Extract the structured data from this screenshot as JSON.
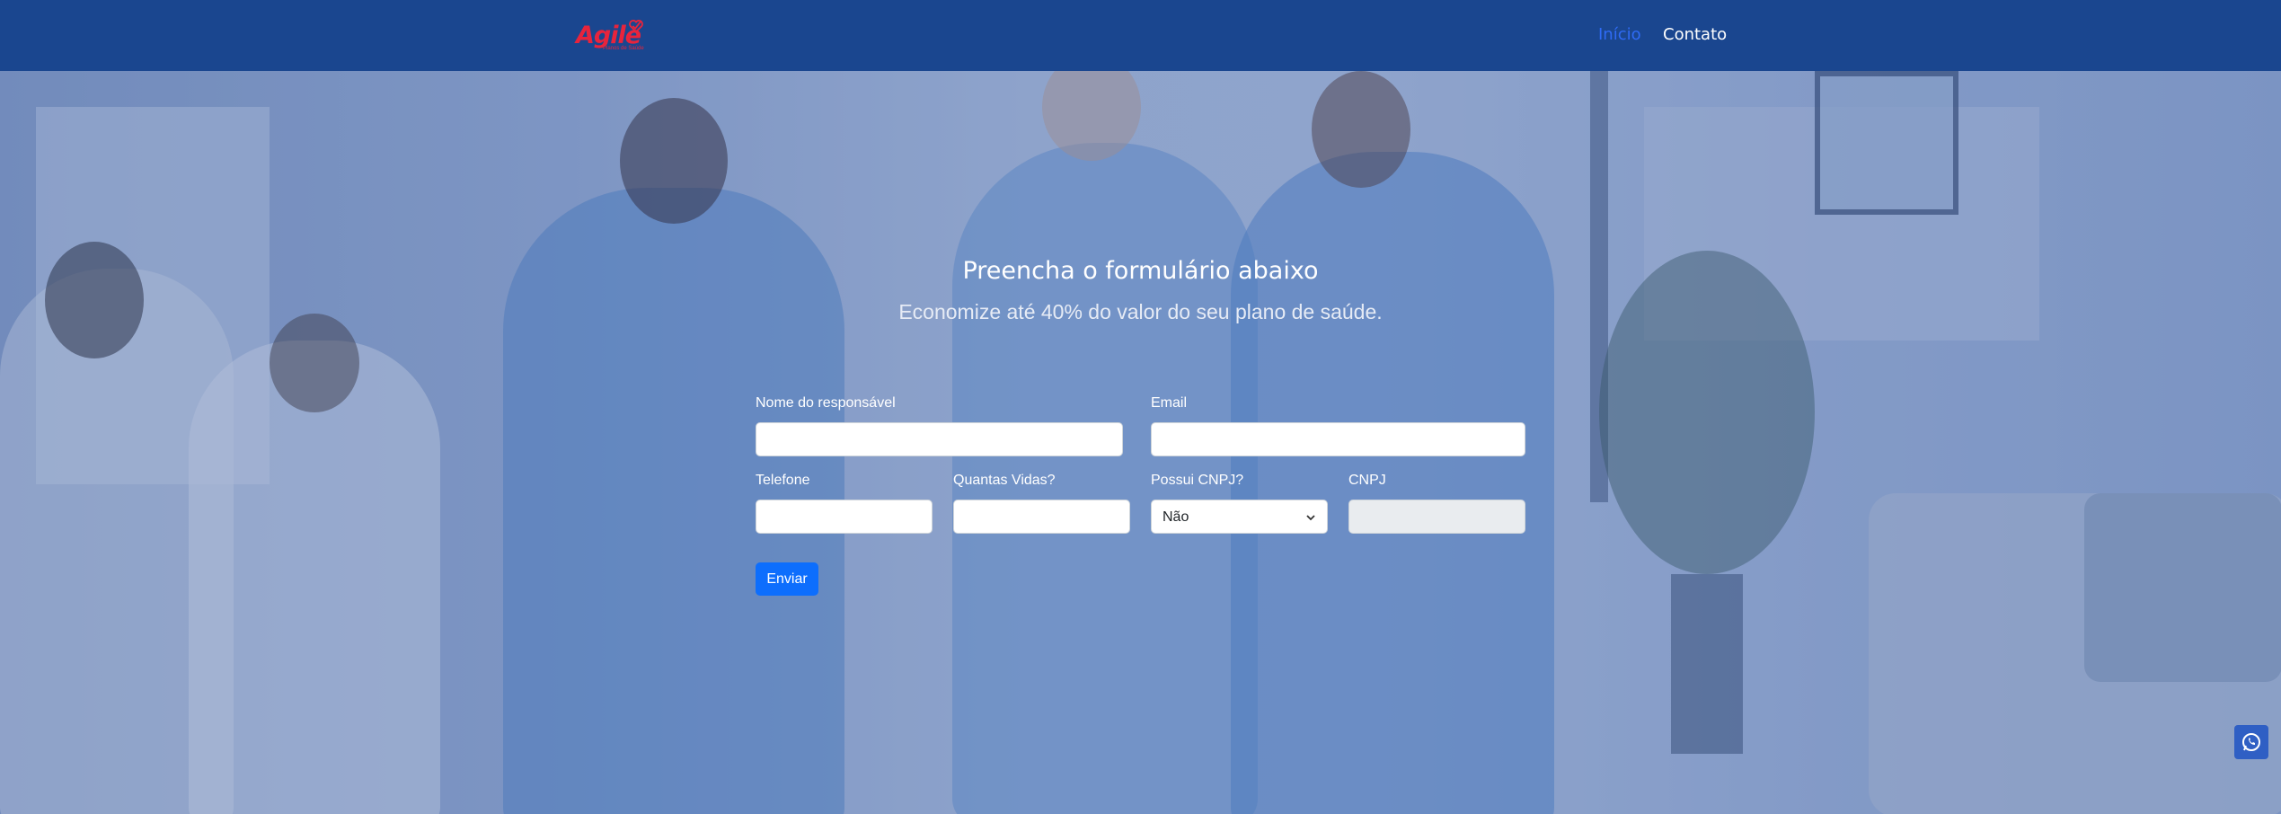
{
  "header": {
    "logo_text": "Agile",
    "logo_tagline": "Planos de Saúde",
    "nav": [
      {
        "label": "Início",
        "active": true
      },
      {
        "label": "Contato",
        "active": false
      }
    ],
    "colors": {
      "background": "#1a468f",
      "active_link": "#2f6bf5",
      "logo": "#e8243c"
    }
  },
  "hero": {
    "title": "Preencha o formulário abaixo",
    "subtitle": "Economize até 40% do valor do seu plano de saúde."
  },
  "form": {
    "fields": {
      "nome": {
        "label": "Nome do responsável",
        "value": "",
        "placeholder": ""
      },
      "email": {
        "label": "Email",
        "value": "",
        "placeholder": ""
      },
      "telefone": {
        "label": "Telefone",
        "value": "",
        "placeholder": ""
      },
      "vidas": {
        "label": "Quantas Vidas?",
        "value": "",
        "placeholder": ""
      },
      "possui_cnpj": {
        "label": "Possui CNPJ?",
        "selected": "Não"
      },
      "cnpj": {
        "label": "CNPJ",
        "value": "",
        "placeholder": "",
        "disabled": true
      }
    },
    "submit_label": "Enviar",
    "colors": {
      "submit": "#0d6efd"
    }
  },
  "floating": {
    "whatsapp_icon": "whatsapp-icon"
  }
}
